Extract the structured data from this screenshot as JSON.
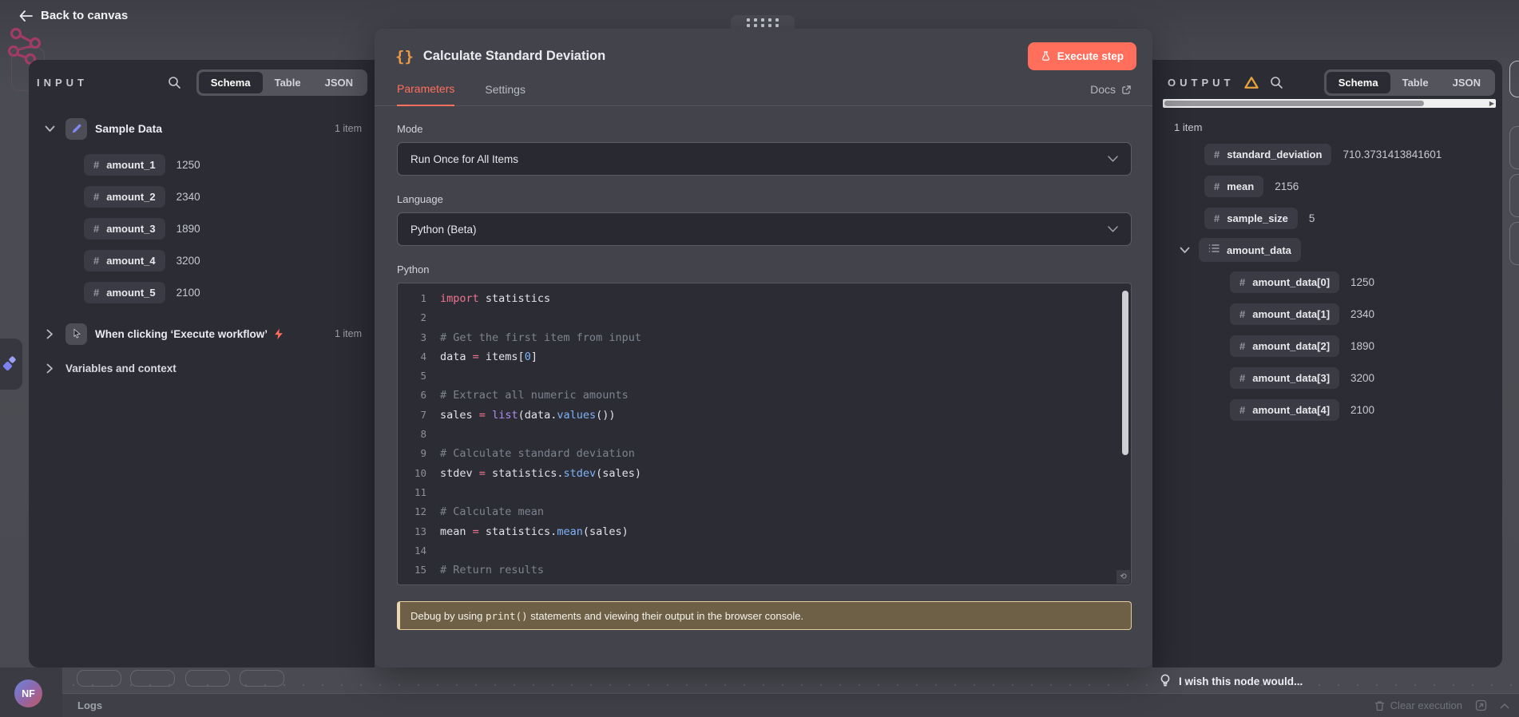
{
  "header": {
    "back_label": "Back to canvas"
  },
  "input_panel": {
    "title": "INPUT",
    "tabs": [
      "Schema",
      "Table",
      "JSON"
    ],
    "active_tab": "Schema",
    "source": {
      "name": "Sample Data",
      "count": "1 item",
      "fields": [
        {
          "name": "amount_1",
          "value": "1250"
        },
        {
          "name": "amount_2",
          "value": "2340"
        },
        {
          "name": "amount_3",
          "value": "1890"
        },
        {
          "name": "amount_4",
          "value": "3200"
        },
        {
          "name": "amount_5",
          "value": "2100"
        }
      ]
    },
    "trigger": {
      "name": "When clicking ‘Execute workflow’",
      "count": "1 item"
    },
    "context_label": "Variables and context"
  },
  "modal": {
    "icon": "{}",
    "title": "Calculate Standard Deviation",
    "execute_label": "Execute step",
    "tabs": {
      "parameters": "Parameters",
      "settings": "Settings"
    },
    "docs_label": "Docs",
    "mode_label": "Mode",
    "mode_value": "Run Once for All Items",
    "language_label": "Language",
    "language_value": "Python (Beta)",
    "editor_label": "Python",
    "code_lines": [
      {
        "n": "1",
        "t": [
          [
            "kw",
            "import"
          ],
          [
            "tx",
            " statistics"
          ]
        ]
      },
      {
        "n": "2",
        "t": []
      },
      {
        "n": "3",
        "t": [
          [
            "cm",
            "# Get the first item from input"
          ]
        ]
      },
      {
        "n": "4",
        "t": [
          [
            "tx",
            "data "
          ],
          [
            "op",
            "="
          ],
          [
            "tx",
            " items["
          ],
          [
            "nm",
            "0"
          ],
          [
            "tx",
            "]"
          ]
        ]
      },
      {
        "n": "5",
        "t": []
      },
      {
        "n": "6",
        "t": [
          [
            "cm",
            "# Extract all numeric amounts"
          ]
        ]
      },
      {
        "n": "7",
        "t": [
          [
            "tx",
            "sales "
          ],
          [
            "op",
            "="
          ],
          [
            "tx",
            " "
          ],
          [
            "fn",
            "list"
          ],
          [
            "tx",
            "(data."
          ],
          [
            "mt",
            "values"
          ],
          [
            "tx",
            "())"
          ]
        ]
      },
      {
        "n": "8",
        "t": []
      },
      {
        "n": "9",
        "t": [
          [
            "cm",
            "# Calculate standard deviation"
          ]
        ]
      },
      {
        "n": "10",
        "t": [
          [
            "tx",
            "stdev "
          ],
          [
            "op",
            "="
          ],
          [
            "tx",
            " statistics."
          ],
          [
            "mt",
            "stdev"
          ],
          [
            "tx",
            "(sales)"
          ]
        ]
      },
      {
        "n": "11",
        "t": []
      },
      {
        "n": "12",
        "t": [
          [
            "cm",
            "# Calculate mean"
          ]
        ]
      },
      {
        "n": "13",
        "t": [
          [
            "tx",
            "mean "
          ],
          [
            "op",
            "="
          ],
          [
            "tx",
            " statistics."
          ],
          [
            "mt",
            "mean"
          ],
          [
            "tx",
            "(sales)"
          ]
        ]
      },
      {
        "n": "14",
        "t": []
      },
      {
        "n": "15",
        "t": [
          [
            "cm",
            "# Return results"
          ]
        ]
      }
    ],
    "hint_parts": [
      [
        "tx",
        "Debug by using "
      ],
      [
        "mono",
        "print()"
      ],
      [
        "tx",
        " statements and viewing their output in the browser console."
      ]
    ]
  },
  "output_panel": {
    "title": "OUTPUT",
    "tabs": [
      "Schema",
      "Table",
      "JSON"
    ],
    "active_tab": "Schema",
    "count": "1 item",
    "fields": [
      {
        "icon": "number",
        "name": "standard_deviation",
        "value": "710.3731413841601"
      },
      {
        "icon": "number",
        "name": "mean",
        "value": "2156"
      },
      {
        "icon": "number",
        "name": "sample_size",
        "value": "5"
      },
      {
        "icon": "list",
        "name": "amount_data",
        "expanded": true,
        "children": [
          {
            "icon": "number",
            "name": "amount_data[0]",
            "value": "1250"
          },
          {
            "icon": "number",
            "name": "amount_data[1]",
            "value": "2340"
          },
          {
            "icon": "number",
            "name": "amount_data[2]",
            "value": "1890"
          },
          {
            "icon": "number",
            "name": "amount_data[3]",
            "value": "3200"
          },
          {
            "icon": "number",
            "name": "amount_data[4]",
            "value": "2100"
          }
        ]
      }
    ]
  },
  "footer": {
    "wish_label": "I wish this node would...",
    "logs_label": "Logs",
    "clear_label": "Clear execution",
    "avatar_initials": "NF"
  },
  "colors": {
    "accent": "#ff6d5a",
    "warning": "#e9a33c",
    "purple": "#8289f2"
  }
}
